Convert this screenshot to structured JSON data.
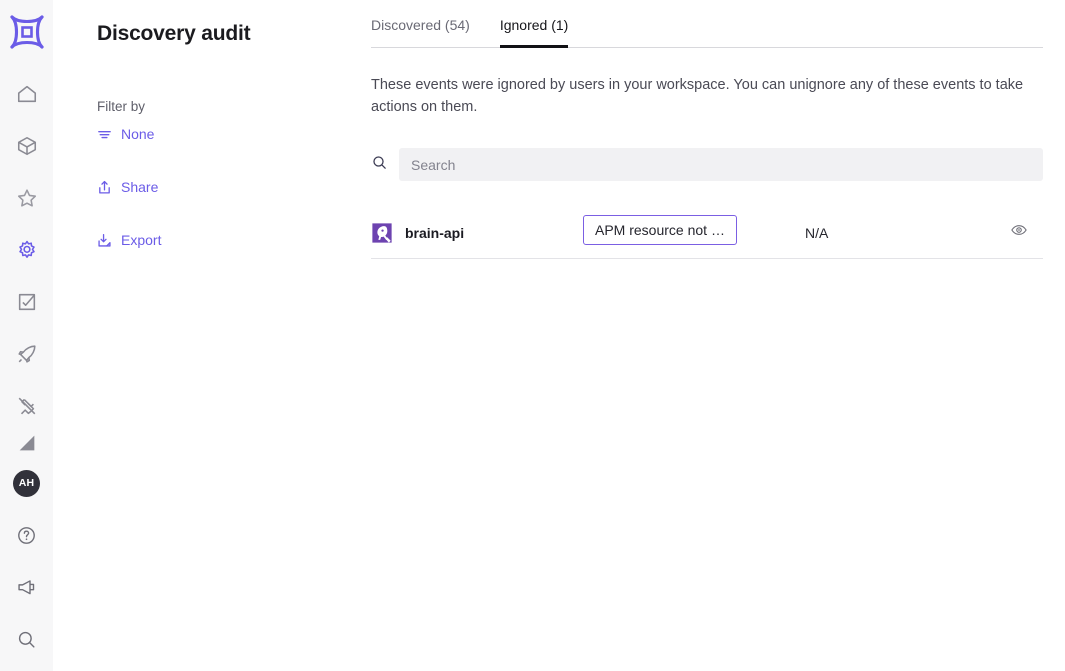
{
  "brand": {
    "accent": "#6b5ce7",
    "logo_icon": "star-burst-logo-icon",
    "avatar_initials": "AH"
  },
  "rail": {
    "items": [
      {
        "icon": "home-icon",
        "name": "home",
        "active": false
      },
      {
        "icon": "cube-icon",
        "name": "catalog",
        "active": false
      },
      {
        "icon": "star-icon",
        "name": "favorites",
        "active": false
      },
      {
        "icon": "gear-icon",
        "name": "settings",
        "active": true
      },
      {
        "icon": "check-square-icon",
        "name": "tasks",
        "active": false
      },
      {
        "icon": "rocket-icon",
        "name": "launch",
        "active": false
      },
      {
        "icon": "plug-icon",
        "name": "integrations",
        "active": false
      },
      {
        "icon": "chart-icon",
        "name": "analytics",
        "active": false
      }
    ],
    "bottom_items": [
      {
        "icon": "help-circle-icon",
        "name": "help"
      },
      {
        "icon": "megaphone-icon",
        "name": "announcements"
      },
      {
        "icon": "search-icon",
        "name": "global-search"
      }
    ]
  },
  "panel": {
    "title": "Discovery audit",
    "filter_label": "Filter by",
    "filter_value": "None",
    "filter_icon": "filter-icon",
    "share_label": "Share",
    "share_icon": "share-icon",
    "export_label": "Export",
    "export_icon": "download-icon"
  },
  "main": {
    "tabs": [
      {
        "label": "Discovered (54)",
        "active": false
      },
      {
        "label": "Ignored (1)",
        "active": true
      }
    ],
    "description": "These events were ignored by users in your workspace. You can unignore any of these events to take actions on them.",
    "search": {
      "icon": "search-icon",
      "value": "",
      "placeholder": "Search"
    },
    "table": {
      "rows": [
        {
          "source_icon": "datadog-logo-icon",
          "name": "brain-api",
          "tag": "APM resource not …",
          "value": "N/A",
          "action_icon": "eye-icon"
        }
      ]
    }
  }
}
